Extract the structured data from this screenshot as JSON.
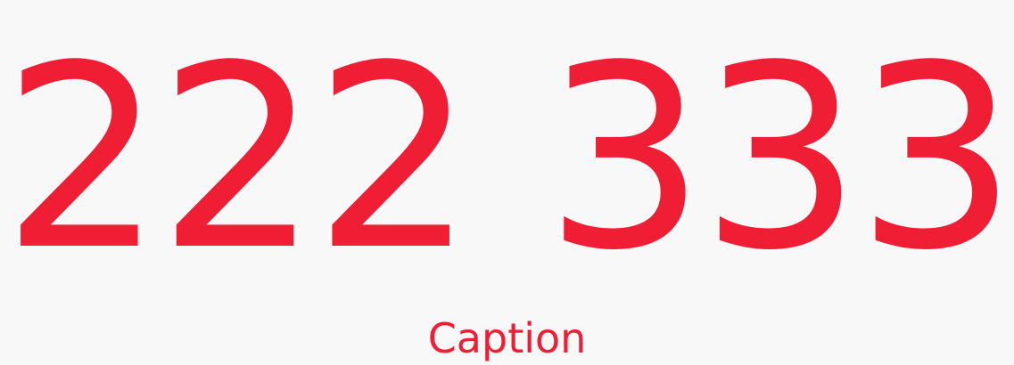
{
  "display": {
    "number": "222 333",
    "caption": "Caption"
  },
  "colors": {
    "background": "#f8f8f8",
    "accent": "#f01e35"
  }
}
